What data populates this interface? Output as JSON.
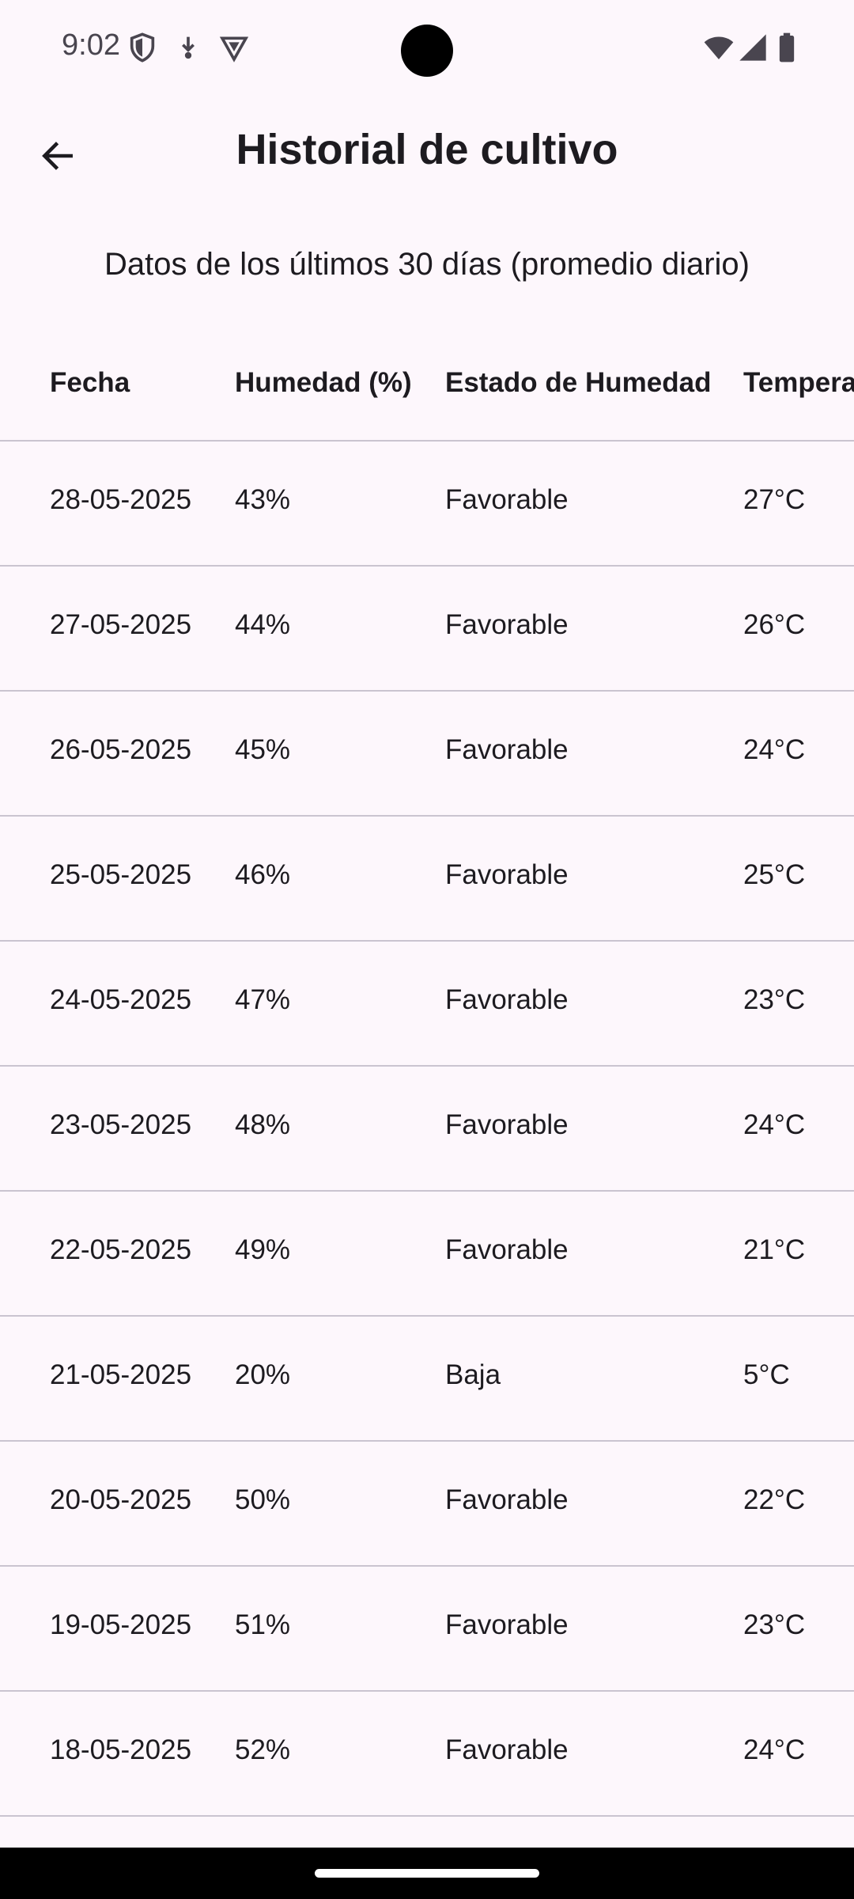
{
  "status_bar": {
    "time": "9:02",
    "left_icons": [
      "shield-icon",
      "download-icon",
      "vpn-icon"
    ],
    "right_icons": [
      "wifi-icon",
      "cellular-signal-icon",
      "battery-icon"
    ]
  },
  "app_bar": {
    "back_icon": "arrow-left-icon",
    "title": "Historial de cultivo"
  },
  "subtitle": "Datos de los últimos 30 días (promedio diario)",
  "table": {
    "columns": [
      "Fecha",
      "Humedad (%)",
      "Estado de Humedad",
      "Temperatura"
    ],
    "rows": [
      {
        "fecha": "28-05-2025",
        "humedad": "43%",
        "estado": "Favorable",
        "temperatura": "27°C"
      },
      {
        "fecha": "27-05-2025",
        "humedad": "44%",
        "estado": "Favorable",
        "temperatura": "26°C"
      },
      {
        "fecha": "26-05-2025",
        "humedad": "45%",
        "estado": "Favorable",
        "temperatura": "24°C"
      },
      {
        "fecha": "25-05-2025",
        "humedad": "46%",
        "estado": "Favorable",
        "temperatura": "25°C"
      },
      {
        "fecha": "24-05-2025",
        "humedad": "47%",
        "estado": "Favorable",
        "temperatura": "23°C"
      },
      {
        "fecha": "23-05-2025",
        "humedad": "48%",
        "estado": "Favorable",
        "temperatura": "24°C"
      },
      {
        "fecha": "22-05-2025",
        "humedad": "49%",
        "estado": "Favorable",
        "temperatura": "21°C"
      },
      {
        "fecha": "21-05-2025",
        "humedad": "20%",
        "estado": "Baja",
        "temperatura": "5°C"
      },
      {
        "fecha": "20-05-2025",
        "humedad": "50%",
        "estado": "Favorable",
        "temperatura": "22°C"
      },
      {
        "fecha": "19-05-2025",
        "humedad": "51%",
        "estado": "Favorable",
        "temperatura": "23°C"
      },
      {
        "fecha": "18-05-2025",
        "humedad": "52%",
        "estado": "Favorable",
        "temperatura": "24°C"
      },
      {
        "fecha": "",
        "humedad": "",
        "estado": "",
        "temperatura": ""
      }
    ]
  },
  "colors": {
    "background": "#fdf7fc",
    "text": "#1d1b20",
    "divider": "#cac4d0",
    "status_icon": "#49454f"
  }
}
